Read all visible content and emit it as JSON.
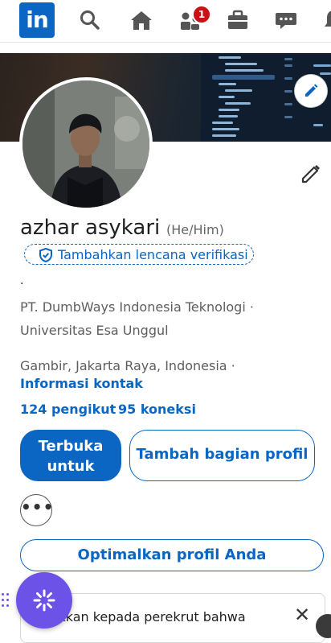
{
  "nav": {
    "logo": "in",
    "notification_count": "1",
    "icons": [
      "search-icon",
      "home-icon",
      "my-network-icon",
      "jobs-icon",
      "messaging-icon",
      "notifications-icon"
    ]
  },
  "profile": {
    "name": "azhar asykari",
    "pronoun": "(He/Him)",
    "verify_label": "Tambahkan lencana verifikasi",
    "headline": ".",
    "company": "PT. DumbWays Indonesia Teknologi ·",
    "education": "Universitas Esa Unggul",
    "location": "Gambir, Jakarta Raya, Indonesia ·",
    "contact_info": "Informasi kontak",
    "followers": "124 pengikut",
    "separator": "·",
    "connections": "95 koneksi"
  },
  "actions": {
    "open_to_line1": "Terbuka",
    "open_to_line2": "untuk",
    "add_section": "Tambah bagian profil",
    "more": "•••",
    "optimize": "Optimalkan profil Anda"
  },
  "card": {
    "text": "ıkkan kepada perekrut bahwa",
    "close": "✕"
  },
  "colors": {
    "brand": "#0a66c2",
    "badge": "#cc1016",
    "fab": "#6d52e8"
  }
}
